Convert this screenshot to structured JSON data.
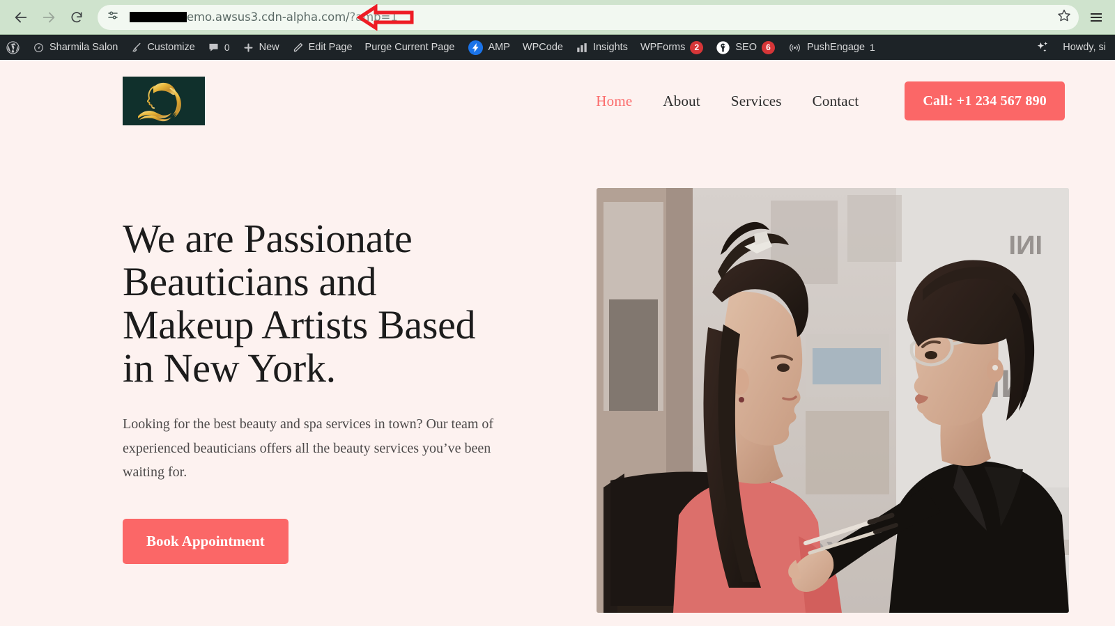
{
  "browser": {
    "back_icon": "back-arrow-icon",
    "forward_icon": "forward-arrow-icon",
    "reload_icon": "reload-icon",
    "site_info_icon": "site-settings-icon",
    "url_visible": "emo.awsus3.cdn-alpha.com/",
    "url_query": "?amp=1",
    "url_redacted": true,
    "bookmark_icon": "bookmark-star-icon",
    "menu_icon": "browser-menu-icon",
    "annotation": "red-left-arrow-pointing-at-url",
    "chrome_color": "#cfe3cd",
    "omnibox_color": "#f2f8f1"
  },
  "adminbar": {
    "background": "#1d2327",
    "badge_color": "#d63638",
    "items": [
      {
        "label": "",
        "icon": "wordpress-logo-icon",
        "count": null
      },
      {
        "label": "Sharmila Salon",
        "icon": "dashboard-icon",
        "count": null
      },
      {
        "label": "Customize",
        "icon": "paintbrush-icon",
        "count": null
      },
      {
        "label": "0",
        "icon": "comment-bubble-icon",
        "count": null
      },
      {
        "label": "New",
        "icon": "plus-icon",
        "count": null
      },
      {
        "label": "Edit Page",
        "icon": "pencil-icon",
        "count": null
      },
      {
        "label": "Purge Current Page",
        "icon": null,
        "count": null
      },
      {
        "label": "AMP",
        "icon": "amp-lightning-icon",
        "count": null
      },
      {
        "label": "WPCode",
        "icon": null,
        "count": null
      },
      {
        "label": "Insights",
        "icon": "bar-chart-icon",
        "count": null
      },
      {
        "label": "WPForms",
        "icon": null,
        "count": "2"
      },
      {
        "label": "SEO",
        "icon": "aioseo-icon",
        "count": "6"
      },
      {
        "label": "PushEngage",
        "icon": "broadcast-icon",
        "count": "1"
      }
    ],
    "right": {
      "sparkle_icon": "sparkles-icon",
      "howdy": "Howdy, si"
    }
  },
  "site": {
    "background": "#fdf2f0",
    "accent": "#fb6767",
    "logo": {
      "name": "salon-woman-face-logo",
      "background": "#10302c",
      "gold": "#f3c košt"
    },
    "nav": [
      {
        "label": "Home",
        "active": true
      },
      {
        "label": "About",
        "active": false
      },
      {
        "label": "Services",
        "active": false
      },
      {
        "label": "Contact",
        "active": false
      }
    ],
    "call_button": "Call: +1 234 567 890"
  },
  "hero": {
    "title": "We are Passionate Beauticians and Makeup Artists Based in New York.",
    "subtitle": "Looking for the best beauty and spa services in town? Our team of experienced beauticians offers all the beauty services you’ve been waiting for.",
    "cta": "Book Appointment",
    "image_alt": "makeup-artist-applying-makeup-to-client-in-salon"
  }
}
